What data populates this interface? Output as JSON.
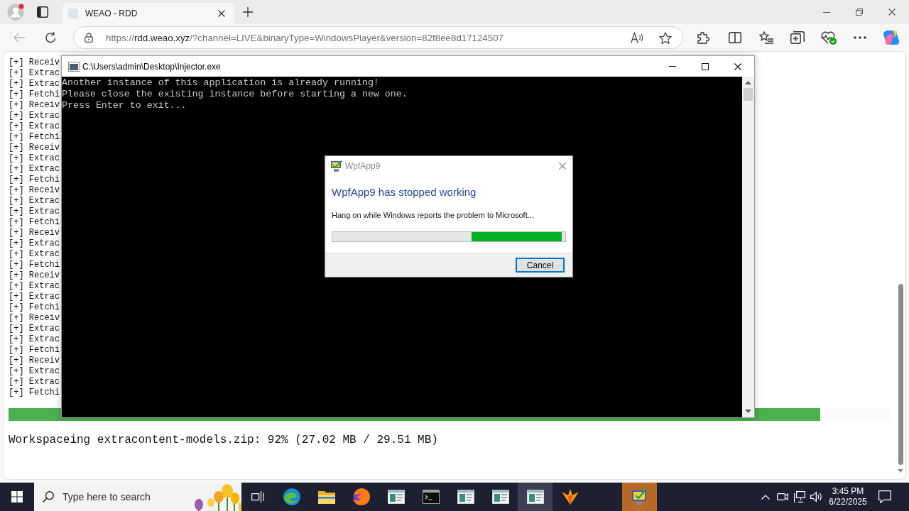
{
  "browser": {
    "tabs": [
      {
        "title": "WEAO - RDD",
        "selected": true
      }
    ],
    "nav_buttons": [
      {
        "kind": "back",
        "disabled": true
      },
      {
        "kind": "refresh",
        "disabled": false
      }
    ],
    "address": {
      "scheme": "https://",
      "host": "rdd.weao.xyz",
      "path": "/?channel=LIVE&binaryType=WindowsPlayer&version=82f8ee8d17124507"
    }
  },
  "page": {
    "log_lines": [
      "[+] Receiv",
      "[+] Extrac",
      "[+] Extrac",
      "[+] Fetchi",
      "[+] Receiv",
      "[+] Extrac",
      "[+] Extrac",
      "[+] Fetchi",
      "[+] Receiv",
      "[+] Extrac",
      "[+] Extrac",
      "[+] Fetchi",
      "[+] Receiv",
      "[+] Extrac",
      "[+] Extrac",
      "[+] Fetchi",
      "[+] Receiv",
      "[+] Extrac",
      "[+] Extrac",
      "[+] Fetchi",
      "[+] Receiv",
      "[+] Extrac",
      "[+] Extrac",
      "[+] Fetchi",
      "[+] Receiv",
      "[+] Extrac",
      "[+] Extrac",
      "[+] Fetchi",
      "[+] Receiv",
      "[+] Extrac",
      "[+] Extrac",
      "[+] Fetchi"
    ],
    "progress": {
      "level": 0.92
    },
    "status": "Workspaceing extracontent-models.zip: 92% (27.02 MB / 29.51 MB)"
  },
  "console_window": {
    "title": "C:\\Users\\admin\\Desktop\\Injector.exe",
    "lines": [
      "Another instance of this application is already running!",
      "Please close the existing instance before starting a new one.",
      "Press Enter to exit..."
    ]
  },
  "error_dialog": {
    "title": "WpfApp9",
    "heading": "WpfApp9 has stopped working",
    "message": "Hang on while Windows reports the problem to Microsoft...",
    "progress": {
      "kind": "marquee"
    },
    "buttons": [
      {
        "label": "Cancel",
        "focused": true
      }
    ]
  },
  "taskbar": {
    "search": {
      "placeholder": "Type here to search"
    },
    "apps": [
      {
        "kind": "swirl",
        "selected": false,
        "attention": false
      },
      {
        "kind": "folder",
        "selected": false,
        "attention": false
      },
      {
        "kind": "fox",
        "selected": false,
        "attention": false
      },
      {
        "kind": "window",
        "selected": false,
        "attention": false
      },
      {
        "kind": "console",
        "selected": false,
        "attention": false
      },
      {
        "kind": "window",
        "selected": false,
        "attention": false
      },
      {
        "kind": "window",
        "selected": false,
        "attention": false
      },
      {
        "kind": "window",
        "selected": true,
        "attention": false
      },
      {
        "kind": "bird",
        "selected": false,
        "attention": false
      },
      {
        "kind": "app",
        "selected": false,
        "attention": true
      }
    ],
    "clock": {
      "time": "3:45 PM",
      "date": "6/22/2025"
    }
  }
}
